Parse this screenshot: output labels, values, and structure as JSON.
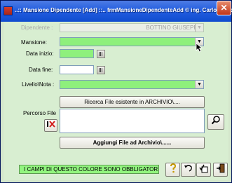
{
  "window": {
    "title": "..:: Mansione Dipendente [Add] ::..   frmMansioneDipendenteAdd © ing. Carlo Scaroni",
    "close_label": "✕"
  },
  "form": {
    "dipendente": {
      "label": "Dipendente :",
      "value": "BOTTINO   GIUSEPPE"
    },
    "mansione": {
      "label": "Mansione:",
      "value": ""
    },
    "data_inizio": {
      "label": "Data inizio:",
      "value": ""
    },
    "data_fine": {
      "label": "Data fine:",
      "value": ""
    },
    "livello_nota": {
      "label": "Livello\\Nota :",
      "value": ""
    },
    "percorso_file": {
      "label": "Percorso File",
      "value": ""
    }
  },
  "buttons": {
    "ricerca_file": "Ricerca File esistente in ARCHIVIO\\....",
    "aggiungi_file": "Aggiungi File ad Archivio\\......"
  },
  "status": {
    "required_notice": "I CAMPI DI QUESTO COLORE SONO OBBLIGATORI"
  },
  "colors": {
    "required_field": "#8ef07c",
    "form_background": "#d8eed1",
    "titlebar": "#245ee0"
  },
  "icons": [
    "app-icon",
    "close-icon",
    "calendar-icon",
    "dropdown-arrow-icon",
    "clear-path-icon",
    "magnifier-icon",
    "help-icon",
    "undo-icon",
    "save-icon",
    "exit-icon"
  ]
}
